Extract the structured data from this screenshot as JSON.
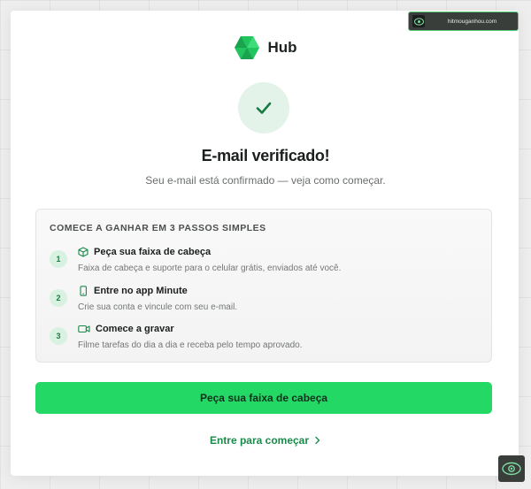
{
  "watermark": {
    "url": "hitmouganhou.com"
  },
  "brand": {
    "name": "Hub",
    "color": "#22c45e"
  },
  "header": {
    "title": "E-mail verificado!",
    "subtitle": "Seu e-mail está confirmado — veja como começar."
  },
  "steps": {
    "heading": "COMECE A GANHAR EM 3 PASSOS SIMPLES",
    "items": [
      {
        "number": "1",
        "icon": "box-icon",
        "title": "Peça sua faixa de cabeça",
        "description": "Faixa de cabeça e suporte para o celular grátis, enviados até você."
      },
      {
        "number": "2",
        "icon": "phone-icon",
        "title": "Entre no app Minute",
        "description": "Crie sua conta e vincule com seu e-mail."
      },
      {
        "number": "3",
        "icon": "video-icon",
        "title": "Comece a gravar",
        "description": "Filme tarefas do dia a dia e receba pelo tempo aprovado."
      }
    ]
  },
  "actions": {
    "primary_label": "Peça sua faixa de cabeça",
    "secondary_label": "Entre para começar"
  },
  "colors": {
    "accent": "#24d866",
    "link": "#1a8a4a",
    "check": "#1a7a44"
  }
}
